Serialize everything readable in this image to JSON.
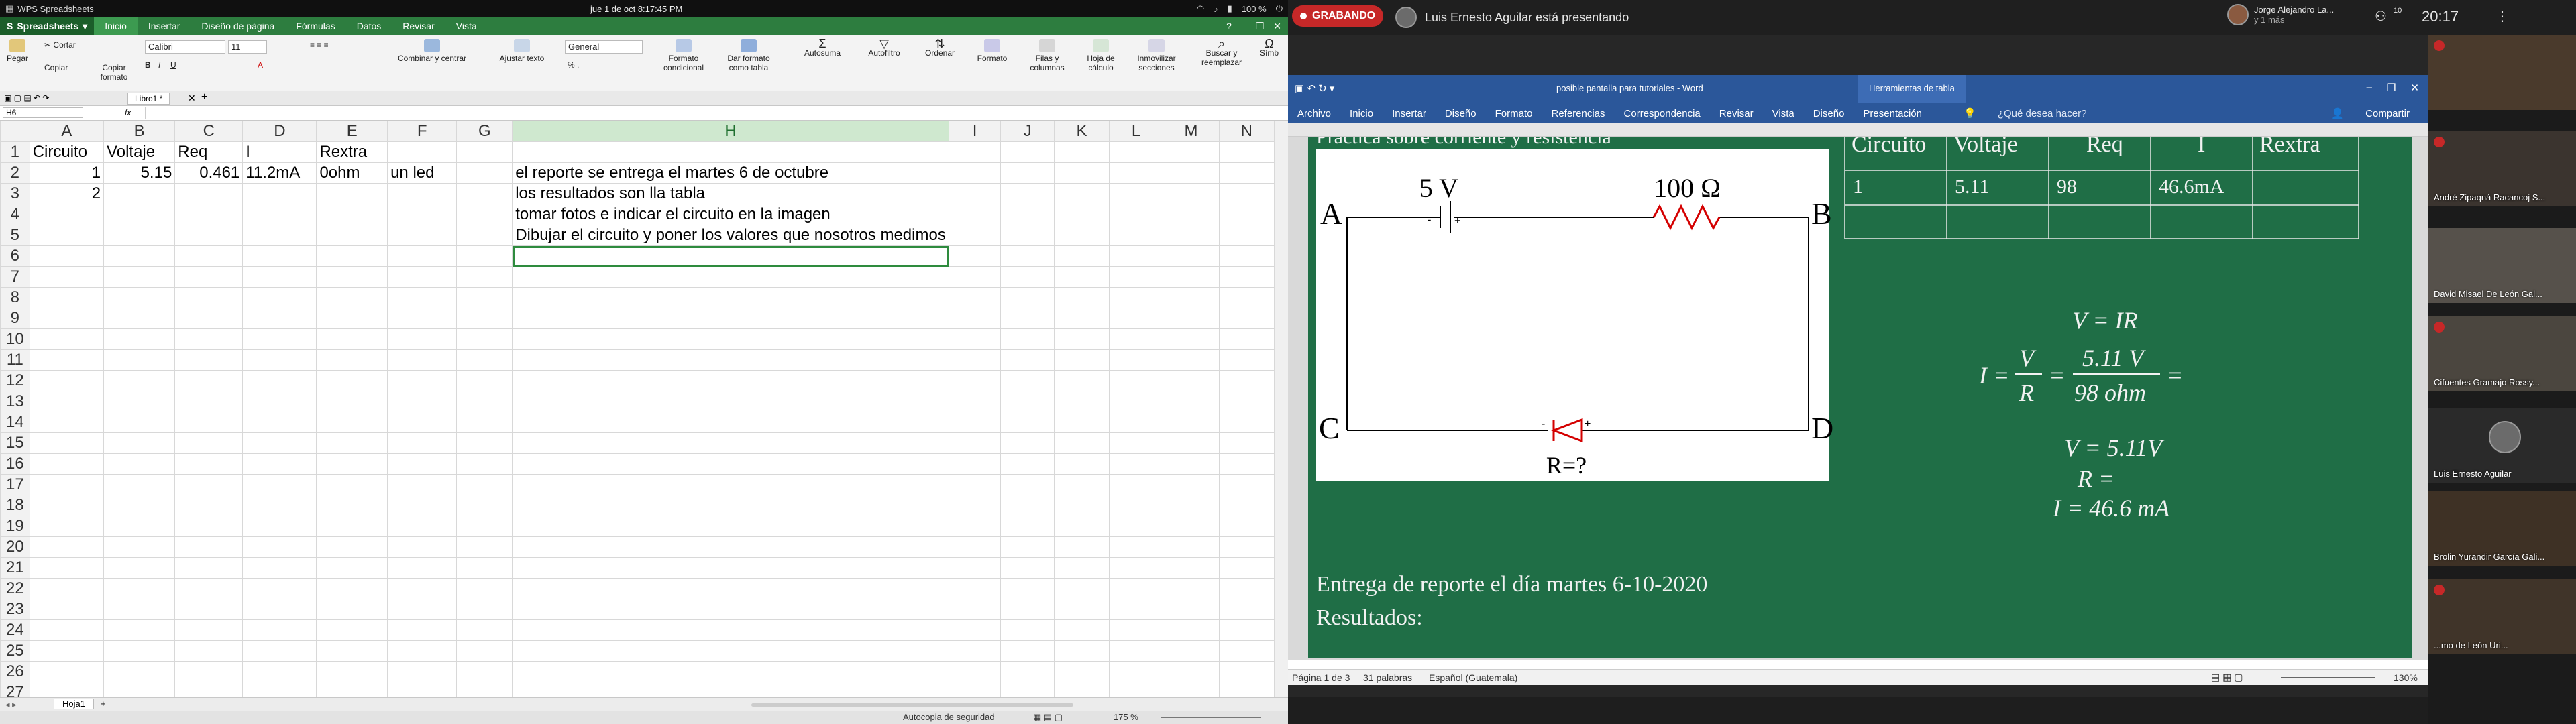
{
  "system": {
    "app_name": "WPS Spreadsheets",
    "clock": "jue  1 de oct  8:17:45 PM",
    "battery": "100 %"
  },
  "wps": {
    "brand": "Spreadsheets",
    "menus": [
      "Inicio",
      "Insertar",
      "Diseño de página",
      "Fórmulas",
      "Datos",
      "Revisar",
      "Vista"
    ],
    "ribbon": {
      "paste": "Pegar",
      "cut": "Cortar",
      "copy": "Copiar",
      "copy_format": "Copiar formato",
      "font_name": "Calibri",
      "font_size": "11",
      "merge": "Combinar y centrar",
      "wrap": "Ajustar texto",
      "number_format": "General",
      "cond_format": "Formato condicional",
      "table_format": "Dar formato como tabla",
      "autosum": "Autosuma",
      "autofilter": "Autofiltro",
      "sort": "Ordenar",
      "format": "Formato",
      "rows_cols": "Filas y columnas",
      "sheet": "Hoja de cálculo",
      "freeze": "Inmovilizar secciones",
      "find": "Buscar y reemplazar",
      "sym": "Símb"
    },
    "book_tab": "Libro1 *",
    "name_box": "H6",
    "fx": "fx",
    "columns": [
      "A",
      "B",
      "C",
      "D",
      "E",
      "F",
      "G",
      "H",
      "I",
      "J",
      "K",
      "L",
      "M",
      "N"
    ],
    "selected_col": "H",
    "rows": [
      {
        "n": "1",
        "A": "Circuito",
        "B": "Voltaje",
        "C": "Req",
        "D": "I",
        "E": "Rextra"
      },
      {
        "n": "2",
        "A": "1",
        "B": "5.15",
        "C": "0.461",
        "D": "11.2mA",
        "E": "0ohm",
        "F": "un led",
        "H": "el reporte se entrega el martes 6 de octubre"
      },
      {
        "n": "3",
        "A": "2",
        "H": "los resultados son lla tabla"
      },
      {
        "n": "4",
        "H": "tomar fotos e indicar el circuito en la imagen"
      },
      {
        "n": "5",
        "H": "Dibujar el circuito y poner los valores que nosotros medimos"
      },
      {
        "n": "6"
      },
      {
        "n": "7"
      },
      {
        "n": "8"
      },
      {
        "n": "9"
      },
      {
        "n": "10"
      },
      {
        "n": "11"
      },
      {
        "n": "12"
      },
      {
        "n": "13"
      },
      {
        "n": "14"
      },
      {
        "n": "15"
      },
      {
        "n": "16"
      },
      {
        "n": "17"
      },
      {
        "n": "18"
      },
      {
        "n": "19"
      },
      {
        "n": "20"
      },
      {
        "n": "21"
      },
      {
        "n": "22"
      },
      {
        "n": "23"
      },
      {
        "n": "24"
      },
      {
        "n": "25"
      },
      {
        "n": "26"
      },
      {
        "n": "27"
      }
    ],
    "sheet_tab": "Hoja1",
    "status": {
      "security": "Autocopia de seguridad",
      "zoom": "175 %"
    }
  },
  "meeting": {
    "recording": "GRABANDO",
    "presenter_text": "Luis Ernesto Aguilar está presentando",
    "peer_name": "Jorge Alejandro La...",
    "peer_sub": "y 1 más",
    "people_count": "10",
    "time": "20:17",
    "participants": [
      "",
      "André Zipaqná Racancoj S...",
      "David Misael De León Gal...",
      "Cifuentes Gramajo Rossy...",
      "Luis Ernesto Aguilar",
      "Brolin Yurandir García Gali...",
      "...mo de León Uri..."
    ]
  },
  "word": {
    "title": "posible pantalla para tutoriales - Word",
    "context_tab": "Herramientas de tabla",
    "menus": [
      "Archivo",
      "Inicio",
      "Insertar",
      "Diseño",
      "Formato",
      "Referencias",
      "Correspondencia",
      "Revisar",
      "Vista",
      "Diseño",
      "Presentación"
    ],
    "tell_me": "¿Qué desea hacer?",
    "share": "Compartir",
    "status_page": "Página 1 de 3",
    "status_words": "31 palabras",
    "status_lang": "Español (Guatemala)",
    "status_zoom": "130%"
  },
  "board": {
    "heading": "Práctica sobre corriente y resistencia",
    "circuit": {
      "voltage": "5 V",
      "resistor": "100 Ω",
      "unknown": "R=?",
      "nodes": [
        "A",
        "B",
        "C",
        "D"
      ]
    },
    "table": {
      "headers": [
        "Circuito",
        "Voltaje",
        "Req",
        "I",
        "Rextra"
      ],
      "rows": [
        [
          "1",
          "5.11",
          "98",
          "46.6mA",
          ""
        ],
        [
          "",
          "",
          "",
          "",
          ""
        ],
        [
          "",
          "",
          "",
          "",
          ""
        ]
      ]
    },
    "formulas": {
      "f1": "V = IR",
      "f2_left": "I =",
      "f2_frac1_num": "V",
      "f2_frac1_den": "R",
      "f2_eq": "=",
      "f2_frac2_num": "5.11 V",
      "f2_frac2_den": "98 ohm",
      "f2_end": "=",
      "f3": "V = 5.11V",
      "f4": "R =",
      "f5": "I = 46.6 mA"
    },
    "delivery": "Entrega de reporte el día martes 6-10-2020",
    "results": "Resultados:"
  }
}
